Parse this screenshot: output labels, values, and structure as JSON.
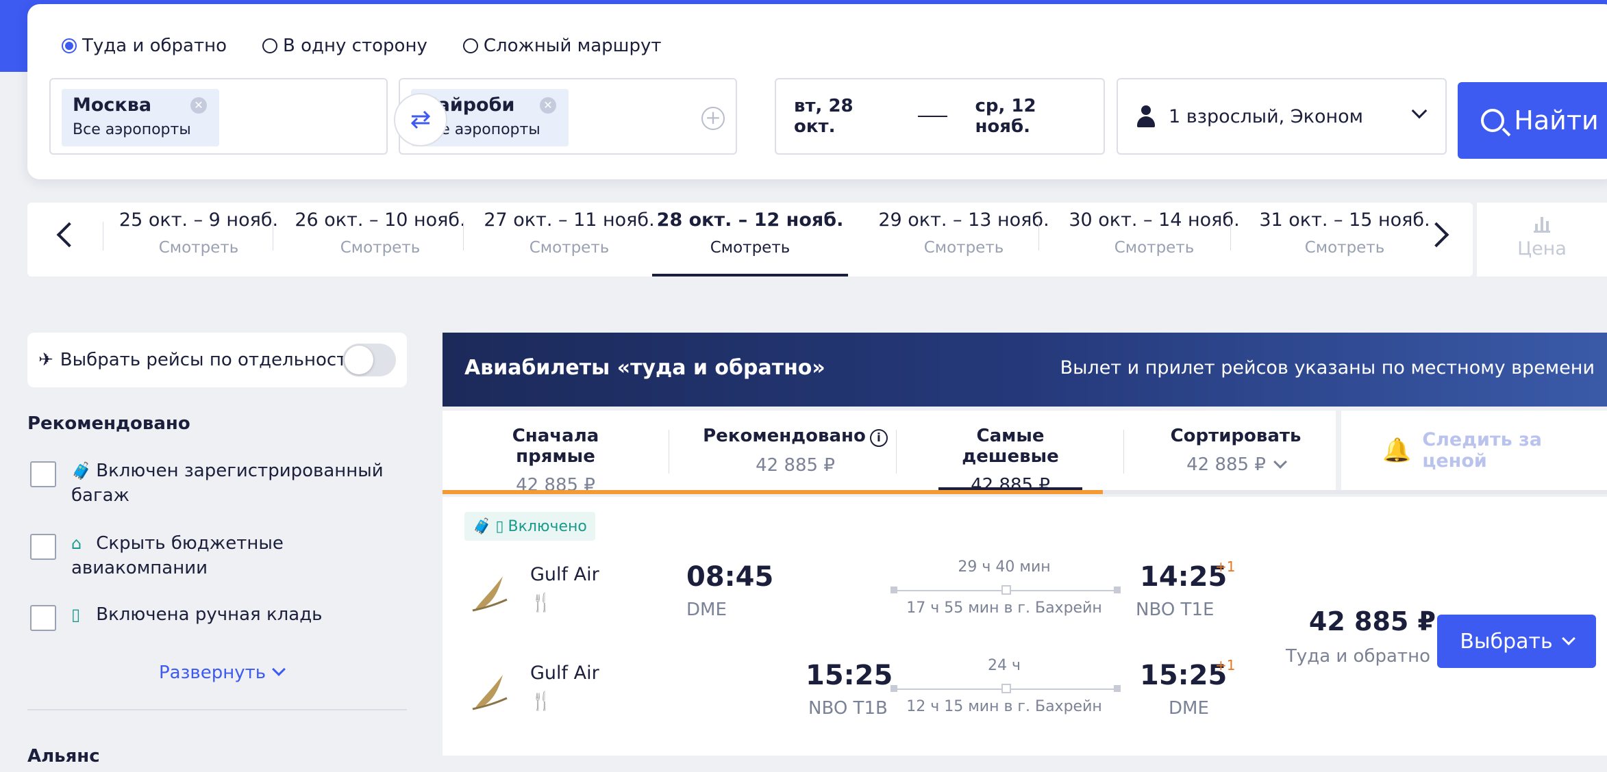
{
  "search": {
    "trip_types": [
      {
        "label": "Туда и обратно",
        "selected": true
      },
      {
        "label": "В одну сторону",
        "selected": false
      },
      {
        "label": "Сложный маршрут",
        "selected": false
      }
    ],
    "origin": {
      "city": "Москва",
      "airports": "Все аэропорты"
    },
    "destination": {
      "city": "Найроби",
      "airports": "Все аэропорты"
    },
    "date_out": "вт, 28 окт.",
    "date_back": "ср, 12 нояб.",
    "passengers": "1 взрослый, Эконом",
    "search_label": "Найти"
  },
  "date_strip": {
    "cells": [
      {
        "range": "25 окт. – 9 нояб.",
        "action": "Смотреть"
      },
      {
        "range": "26 окт. – 10 нояб.",
        "action": "Смотреть"
      },
      {
        "range": "27 окт. – 11 нояб.",
        "action": "Смотреть"
      },
      {
        "range": "28 окт. – 12 нояб.",
        "action": "Смотреть",
        "active": true
      },
      {
        "range": "29 окт. – 13 нояб.",
        "action": "Смотреть"
      },
      {
        "range": "30 окт. – 14 нояб.",
        "action": "Смотреть"
      },
      {
        "range": "31 окт. – 15 нояб.",
        "action": "Смотреть"
      }
    ],
    "price_tab": "Цена"
  },
  "sidebar": {
    "separate_flights": "Выбрать рейсы по отдельности",
    "recommended_title": "Рекомендовано",
    "filters": [
      {
        "label": "Включен зарегистрированный багаж",
        "icon": "suitcase-icon"
      },
      {
        "label": "Скрыть бюджетные авиакомпании",
        "icon": "tag-icon"
      },
      {
        "label": "Включена ручная кладь",
        "icon": "carry-on-icon"
      }
    ],
    "expand_label": "Развернуть",
    "alliance_title": "Альянс"
  },
  "results": {
    "banner_title": "Авиабилеты «туда и обратно»",
    "banner_note": "Вылет и прилет рейсов указаны по местному времени",
    "sort_tabs": [
      {
        "name": "Сначала прямые",
        "price": "42 885 ₽"
      },
      {
        "name": "Рекомендовано",
        "price": "42 885 ₽"
      },
      {
        "name": "Самые дешевые",
        "price": "42 885 ₽",
        "active": true
      },
      {
        "name": "Сортировать",
        "price": "42 885 ₽"
      }
    ],
    "track_price": "Следить за ценой",
    "offer": {
      "badge": "Включено",
      "segments": [
        {
          "airline": "Gulf Air",
          "dep_time": "08:45",
          "dep_code": "DME",
          "duration": "29 ч 40 мин",
          "layover": "17 ч 55 мин в г. Бахрейн",
          "arr_time": "14:25",
          "arr_code": "NBO T1E",
          "day_shift": "+1"
        },
        {
          "airline": "Gulf Air",
          "dep_time": "15:25",
          "dep_code": "NBO T1B",
          "duration": "24 ч",
          "layover": "12 ч 15 мин в г. Бахрейн",
          "arr_time": "15:25",
          "arr_code": "DME",
          "day_shift": "+1"
        }
      ],
      "price": "42 885 ₽",
      "price_note": "Туда и обратно",
      "select_label": "Выбрать"
    }
  }
}
